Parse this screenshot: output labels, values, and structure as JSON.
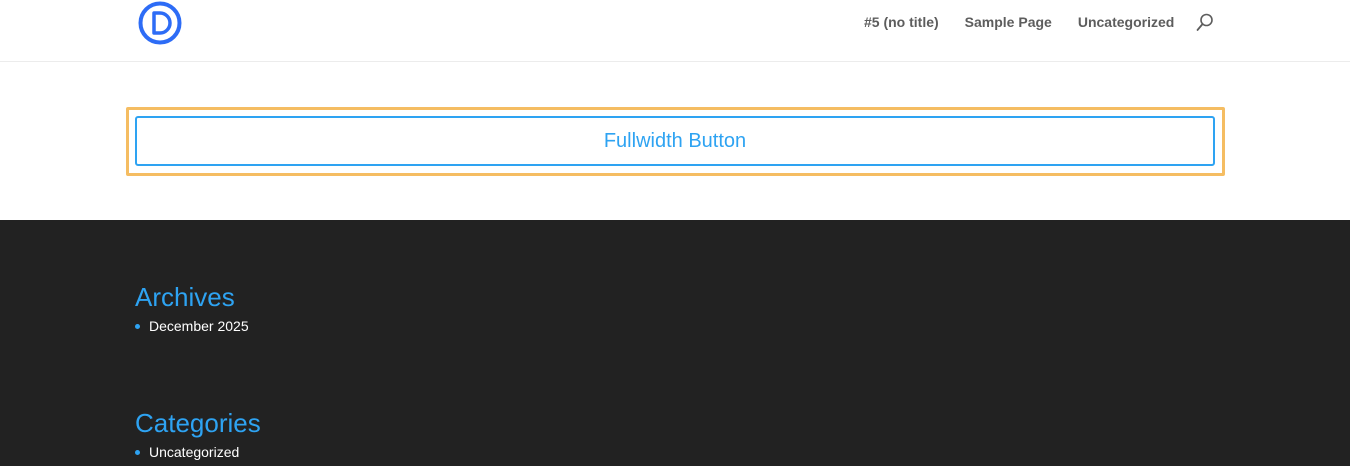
{
  "header": {
    "logo_icon": "divi-d-logo-icon",
    "nav_items": [
      "#5 (no title)",
      "Sample Page",
      "Uncategorized"
    ],
    "search_icon": "search-icon"
  },
  "main": {
    "button_label": "Fullwidth Button"
  },
  "footer": {
    "archives": {
      "title": "Archives",
      "items": [
        "December 2025"
      ]
    },
    "categories": {
      "title": "Categories",
      "items": [
        "Uncategorized"
      ]
    }
  },
  "colors": {
    "accent": "#2ea3f2",
    "focus_outline": "#f5bd62",
    "footer_bg": "#222222",
    "nav_text": "#5d5d5d"
  }
}
